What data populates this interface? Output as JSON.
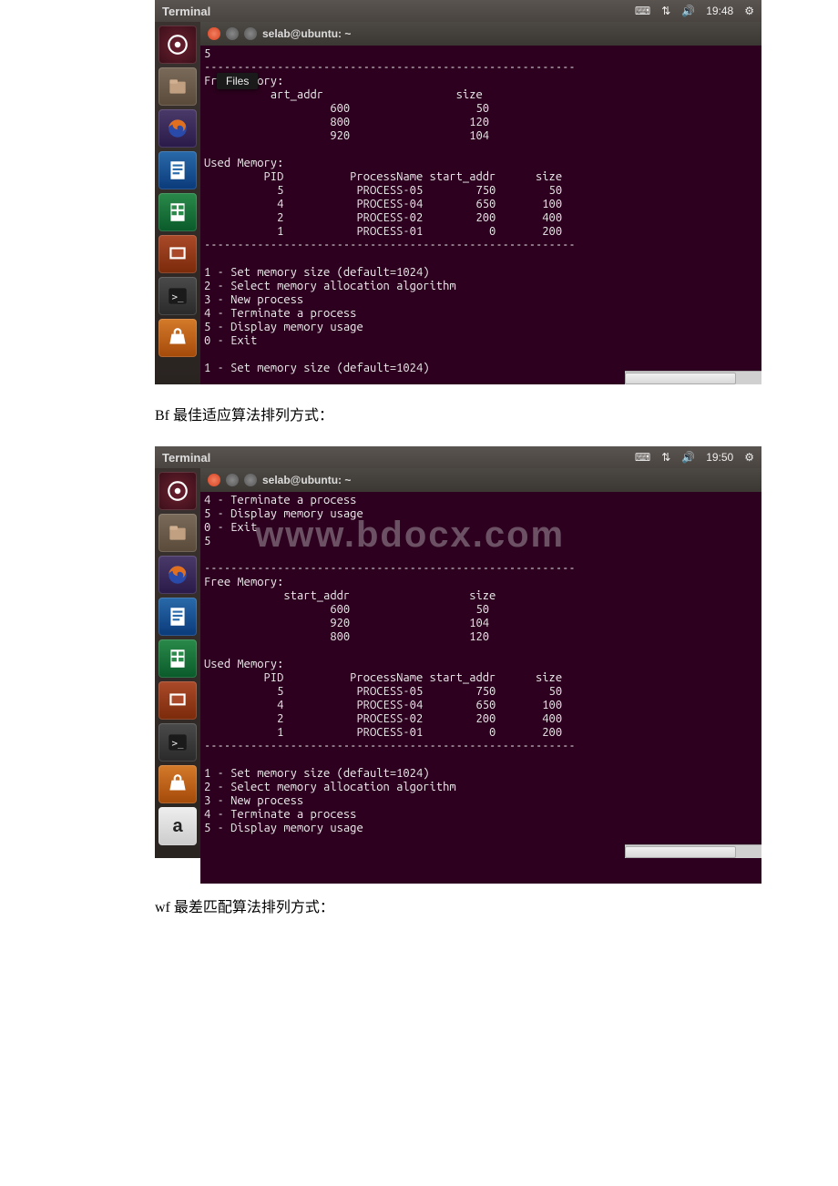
{
  "captions": {
    "bf": "Bf 最佳适应算法排列方式：",
    "wf": "wf 最差匹配算法排列方式："
  },
  "menubar": {
    "title": "Terminal",
    "tray": {
      "keyboard_icon": "keyboard-icon",
      "network_icon": "network-icon",
      "sound_icon": "sound-icon",
      "gear_icon": "gear-icon"
    }
  },
  "shot1": {
    "time": "19:48",
    "window_title": "selab@ubuntu: ~",
    "tooltip": "Files",
    "body_lines": [
      "5",
      "--------------------------------------------------------",
      "Free Memory:",
      "          art_addr                    size",
      "                   600                   50",
      "                   800                  120",
      "                   920                  104",
      "",
      "Used Memory:",
      "         PID          ProcessName start_addr      size",
      "           5           PROCESS-05        750        50",
      "           4           PROCESS-04        650       100",
      "           2           PROCESS-02        200       400",
      "           1           PROCESS-01          0       200",
      "--------------------------------------------------------",
      "",
      "1 - Set memory size (default=1024)",
      "2 - Select memory allocation algorithm",
      "3 - New process",
      "4 - Terminate a process",
      "5 - Display memory usage",
      "0 - Exit",
      "",
      "1 - Set memory size (default=1024)"
    ]
  },
  "shot2": {
    "time": "19:50",
    "window_title": "selab@ubuntu: ~",
    "watermark": "www.bdocx.com",
    "body_lines": [
      "4 - Terminate a process",
      "5 - Display memory usage",
      "0 - Exit",
      "5",
      "",
      "--------------------------------------------------------",
      "Free Memory:",
      "            start_addr                  size",
      "                   600                   50",
      "                   920                  104",
      "                   800                  120",
      "",
      "Used Memory:",
      "         PID          ProcessName start_addr      size",
      "           5           PROCESS-05        750        50",
      "           4           PROCESS-04        650       100",
      "           2           PROCESS-02        200       400",
      "           1           PROCESS-01          0       200",
      "--------------------------------------------------------",
      "",
      "1 - Set memory size (default=1024)",
      "2 - Select memory allocation algorithm",
      "3 - New process",
      "4 - Terminate a process",
      "5 - Display memory usage"
    ]
  },
  "launcher": {
    "items": [
      "dash",
      "files",
      "firefox",
      "writer",
      "calc",
      "impress",
      "terminal",
      "software",
      "amazon"
    ]
  }
}
